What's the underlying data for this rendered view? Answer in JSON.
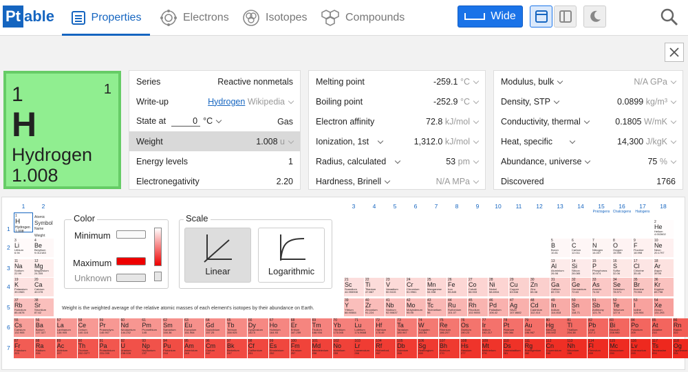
{
  "app": {
    "logo_pt": "Pt",
    "logo_able": "able"
  },
  "nav": {
    "tabs": [
      {
        "label": "Properties",
        "icon": "list-icon",
        "active": true
      },
      {
        "label": "Electrons",
        "icon": "atom-orbit-icon",
        "active": false
      },
      {
        "label": "Isotopes",
        "icon": "isotope-cluster-icon",
        "active": false
      },
      {
        "label": "Compounds",
        "icon": "hexagon-molecule-icon",
        "active": false
      }
    ],
    "wide_label": "Wide",
    "accent": "#1565c0",
    "button_blue": "#1a73e8"
  },
  "element": {
    "number": "1",
    "valence": "1",
    "symbol": "H",
    "name": "Hydrogen",
    "mass": "1.008",
    "color": "#90ee90"
  },
  "panel1": [
    {
      "label": "Series",
      "value": "Reactive nonmetals"
    },
    {
      "label": "Write-up",
      "link": "Hydrogen",
      "source": "Wikipedia"
    },
    {
      "label": "State at",
      "temp": "0",
      "unit": "°C",
      "value": "Gas"
    },
    {
      "label": "Weight",
      "value": "1.008",
      "unit": "u"
    },
    {
      "label": "Energy levels",
      "value": "1"
    },
    {
      "label": "Electronegativity",
      "value": "2.20"
    }
  ],
  "panel2": [
    {
      "label": "Melting point",
      "value": "-259.1",
      "unit": "°C"
    },
    {
      "label": "Boiling point",
      "value": "-252.9",
      "unit": "°C"
    },
    {
      "label": "Electron affinity",
      "value": "72.8",
      "unit": "kJ/mol"
    },
    {
      "label": "Ionization, 1st",
      "value": "1,312.0",
      "unit": "kJ/mol"
    },
    {
      "label": "Radius, calculated",
      "value": "53",
      "unit": "pm"
    },
    {
      "label": "Hardness, Brinell",
      "value": "N/A",
      "unit": "MPa"
    }
  ],
  "panel3": [
    {
      "label": "Modulus, bulk",
      "value": "N/A",
      "unit": "GPa"
    },
    {
      "label": "Density, STP",
      "value": "0.0899",
      "unit": "kg/m³"
    },
    {
      "label": "Conductivity, thermal",
      "value": "0.1805",
      "unit": "W/mK"
    },
    {
      "label": "Heat, specific",
      "value": "14,300",
      "unit": "J/kgK"
    },
    {
      "label": "Abundance, universe",
      "value": "75",
      "unit": "%"
    },
    {
      "label": "Discovered",
      "value": "1766"
    }
  ],
  "legend": {
    "number": "1",
    "symbol": "H",
    "name": "Hydrogen",
    "weight": "1.008",
    "text_atomic": "Atomic",
    "text_symbol": "Symbol",
    "text_name": "Name",
    "text_weight": "Weight"
  },
  "color_box": {
    "title": "Color",
    "min_label": "Minimum",
    "max_label": "Maximum",
    "unknown_label": "Unknown",
    "max_color": "#ee0000"
  },
  "scale_box": {
    "title": "Scale",
    "linear": "Linear",
    "log": "Logarithmic"
  },
  "caption": "Weight is the weighted average of the relative atomic masses of each element's isotopes by their abundance on Earth.",
  "groups": [
    "1",
    "2",
    "3",
    "4",
    "5",
    "6",
    "7",
    "8",
    "9",
    "10",
    "11",
    "12",
    "13",
    "14",
    "15",
    "16",
    "17",
    "18"
  ],
  "group_subs": {
    "15": "Pnictogens",
    "16": "Chalcogens",
    "17": "Halogens"
  },
  "periods": [
    "1",
    "2",
    "3",
    "4",
    "5",
    "6",
    "7"
  ],
  "elements": [
    {
      "n": "1",
      "s": "H",
      "name": "Hydrogen",
      "w": "1.008",
      "row": 1,
      "col": 1
    },
    {
      "n": "2",
      "s": "He",
      "name": "Helium",
      "w": "4.002602",
      "row": 1,
      "col": 18
    },
    {
      "n": "3",
      "s": "Li",
      "name": "Lithium",
      "w": "6.94",
      "row": 2,
      "col": 1
    },
    {
      "n": "4",
      "s": "Be",
      "name": "Beryllium",
      "w": "9.012183",
      "row": 2,
      "col": 2
    },
    {
      "n": "5",
      "s": "B",
      "name": "Boron",
      "w": "10.81",
      "row": 2,
      "col": 13
    },
    {
      "n": "6",
      "s": "C",
      "name": "Carbon",
      "w": "12.011",
      "row": 2,
      "col": 14
    },
    {
      "n": "7",
      "s": "N",
      "name": "Nitrogen",
      "w": "14.007",
      "row": 2,
      "col": 15
    },
    {
      "n": "8",
      "s": "O",
      "name": "Oxygen",
      "w": "15.999",
      "row": 2,
      "col": 16
    },
    {
      "n": "9",
      "s": "F",
      "name": "Fluorine",
      "w": "18.998",
      "row": 2,
      "col": 17
    },
    {
      "n": "10",
      "s": "Ne",
      "name": "Neon",
      "w": "20.1797",
      "row": 2,
      "col": 18
    },
    {
      "n": "11",
      "s": "Na",
      "name": "Sodium",
      "w": "22.99",
      "row": 3,
      "col": 1
    },
    {
      "n": "12",
      "s": "Mg",
      "name": "Magnesium",
      "w": "24.305",
      "row": 3,
      "col": 2
    },
    {
      "n": "13",
      "s": "Al",
      "name": "Aluminium",
      "w": "26.98",
      "row": 3,
      "col": 13
    },
    {
      "n": "14",
      "s": "Si",
      "name": "Silicon",
      "w": "28.085",
      "row": 3,
      "col": 14
    },
    {
      "n": "15",
      "s": "P",
      "name": "Phosphorus",
      "w": "30.974",
      "row": 3,
      "col": 15
    },
    {
      "n": "16",
      "s": "S",
      "name": "Sulfur",
      "w": "32.06",
      "row": 3,
      "col": 16
    },
    {
      "n": "17",
      "s": "Cl",
      "name": "Chlorine",
      "w": "35.45",
      "row": 3,
      "col": 17
    },
    {
      "n": "18",
      "s": "Ar",
      "name": "Argon",
      "w": "39.95",
      "row": 3,
      "col": 18
    },
    {
      "n": "19",
      "s": "K",
      "name": "Potassium",
      "w": "39.0983",
      "row": 4,
      "col": 1
    },
    {
      "n": "20",
      "s": "Ca",
      "name": "Calcium",
      "w": "40.078",
      "row": 4,
      "col": 2
    },
    {
      "n": "21",
      "s": "Sc",
      "name": "Scandium",
      "w": "44.955908",
      "row": 4,
      "col": 3
    },
    {
      "n": "22",
      "s": "Ti",
      "name": "Titanium",
      "w": "47.867",
      "row": 4,
      "col": 4
    },
    {
      "n": "23",
      "s": "V",
      "name": "Vanadium",
      "w": "50.9415",
      "row": 4,
      "col": 5
    },
    {
      "n": "24",
      "s": "Cr",
      "name": "Chromium",
      "w": "51.9961",
      "row": 4,
      "col": 6
    },
    {
      "n": "25",
      "s": "Mn",
      "name": "Manganese",
      "w": "54.938",
      "row": 4,
      "col": 7
    },
    {
      "n": "26",
      "s": "Fe",
      "name": "Iron",
      "w": "55.845",
      "row": 4,
      "col": 8
    },
    {
      "n": "27",
      "s": "Co",
      "name": "Cobalt",
      "w": "58.933",
      "row": 4,
      "col": 9
    },
    {
      "n": "28",
      "s": "Ni",
      "name": "Nickel",
      "w": "58.6934",
      "row": 4,
      "col": 10
    },
    {
      "n": "29",
      "s": "Cu",
      "name": "Copper",
      "w": "63.546",
      "row": 4,
      "col": 11
    },
    {
      "n": "30",
      "s": "Zn",
      "name": "Zinc",
      "w": "65.38",
      "row": 4,
      "col": 12
    },
    {
      "n": "31",
      "s": "Ga",
      "name": "Gallium",
      "w": "69.723",
      "row": 4,
      "col": 13
    },
    {
      "n": "32",
      "s": "Ge",
      "name": "Germanium",
      "w": "72.63",
      "row": 4,
      "col": 14
    },
    {
      "n": "33",
      "s": "As",
      "name": "Arsenic",
      "w": "74.92",
      "row": 4,
      "col": 15
    },
    {
      "n": "34",
      "s": "Se",
      "name": "Selenium",
      "w": "78.971",
      "row": 4,
      "col": 16
    },
    {
      "n": "35",
      "s": "Br",
      "name": "Bromine",
      "w": "79.904",
      "row": 4,
      "col": 17
    },
    {
      "n": "36",
      "s": "Kr",
      "name": "Krypton",
      "w": "83.798",
      "row": 4,
      "col": 18
    },
    {
      "n": "37",
      "s": "Rb",
      "name": "Rubidium",
      "w": "85.4678",
      "row": 5,
      "col": 1
    },
    {
      "n": "38",
      "s": "Sr",
      "name": "Strontium",
      "w": "87.62",
      "row": 5,
      "col": 2
    },
    {
      "n": "39",
      "s": "Y",
      "name": "Yttrium",
      "w": "88.90584",
      "row": 5,
      "col": 3
    },
    {
      "n": "40",
      "s": "Zr",
      "name": "Zirconium",
      "w": "91.224",
      "row": 5,
      "col": 4
    },
    {
      "n": "41",
      "s": "Nb",
      "name": "Niobium",
      "w": "92.90637",
      "row": 5,
      "col": 5
    },
    {
      "n": "42",
      "s": "Mo",
      "name": "Molybdenum",
      "w": "95.95",
      "row": 5,
      "col": 6
    },
    {
      "n": "43",
      "s": "Tc",
      "name": "Technetium",
      "w": "98",
      "row": 5,
      "col": 7
    },
    {
      "n": "44",
      "s": "Ru",
      "name": "Ruthenium",
      "w": "101.07",
      "row": 5,
      "col": 8
    },
    {
      "n": "45",
      "s": "Rh",
      "name": "Rhodium",
      "w": "102.9055",
      "row": 5,
      "col": 9
    },
    {
      "n": "46",
      "s": "Pd",
      "name": "Palladium",
      "w": "106.42",
      "row": 5,
      "col": 10
    },
    {
      "n": "47",
      "s": "Ag",
      "name": "Silver",
      "w": "107.8682",
      "row": 5,
      "col": 11
    },
    {
      "n": "48",
      "s": "Cd",
      "name": "Cadmium",
      "w": "112.414",
      "row": 5,
      "col": 12
    },
    {
      "n": "49",
      "s": "In",
      "name": "Indium",
      "w": "114.818",
      "row": 5,
      "col": 13
    },
    {
      "n": "50",
      "s": "Sn",
      "name": "Tin",
      "w": "118.71",
      "row": 5,
      "col": 14
    },
    {
      "n": "51",
      "s": "Sb",
      "name": "Antimony",
      "w": "121.76",
      "row": 5,
      "col": 15
    },
    {
      "n": "52",
      "s": "Te",
      "name": "Tellurium",
      "w": "127.6",
      "row": 5,
      "col": 16
    },
    {
      "n": "53",
      "s": "I",
      "name": "Iodine",
      "w": "126.904",
      "row": 5,
      "col": 17
    },
    {
      "n": "54",
      "s": "Xe",
      "name": "Xenon",
      "w": "131.293",
      "row": 5,
      "col": 18
    },
    {
      "n": "55",
      "s": "Cs",
      "name": "Caesium",
      "w": "132.905",
      "row": 6,
      "col": 1
    },
    {
      "n": "56",
      "s": "Ba",
      "name": "Barium",
      "w": "137.327",
      "row": 6,
      "col": 2
    },
    {
      "n": "57",
      "s": "La",
      "name": "Lanthanum",
      "w": "138.905",
      "row": 6,
      "col": 3
    },
    {
      "n": "58",
      "s": "Ce",
      "name": "Cerium",
      "w": "140.116",
      "row": 6,
      "col": 4
    },
    {
      "n": "59",
      "s": "Pr",
      "name": "Praseodym.",
      "w": "140.907",
      "row": 6,
      "col": 5
    },
    {
      "n": "60",
      "s": "Nd",
      "name": "Neodymium",
      "w": "144.242",
      "row": 6,
      "col": 6
    },
    {
      "n": "61",
      "s": "Pm",
      "name": "Promethium",
      "w": "145",
      "row": 6,
      "col": 7
    },
    {
      "n": "62",
      "s": "Sm",
      "name": "Samarium",
      "w": "150.36",
      "row": 6,
      "col": 8
    },
    {
      "n": "63",
      "s": "Eu",
      "name": "Europium",
      "w": "151.964",
      "row": 6,
      "col": 9
    },
    {
      "n": "64",
      "s": "Gd",
      "name": "Gadolinium",
      "w": "157.25",
      "row": 6,
      "col": 10
    },
    {
      "n": "65",
      "s": "Tb",
      "name": "Terbium",
      "w": "158.925",
      "row": 6,
      "col": 11
    },
    {
      "n": "66",
      "s": "Dy",
      "name": "Dysprosium",
      "w": "162.5",
      "row": 6,
      "col": 12
    },
    {
      "n": "67",
      "s": "Ho",
      "name": "Holmium",
      "w": "164.93",
      "row": 6,
      "col": 13
    },
    {
      "n": "68",
      "s": "Er",
      "name": "Erbium",
      "w": "167.259",
      "row": 6,
      "col": 14
    },
    {
      "n": "69",
      "s": "Tm",
      "name": "Thulium",
      "w": "168.934",
      "row": 6,
      "col": 15
    },
    {
      "n": "70",
      "s": "Yb",
      "name": "Ytterbium",
      "w": "173.045",
      "row": 6,
      "col": 16
    },
    {
      "n": "71",
      "s": "Lu",
      "name": "Lutetium",
      "w": "174.9668",
      "row": 6,
      "col": 17
    },
    {
      "n": "72",
      "s": "Hf",
      "name": "Hafnium",
      "w": "178.49",
      "row": 6,
      "col": 18
    },
    {
      "n": "73",
      "s": "Ta",
      "name": "Tantalum",
      "w": "180.947",
      "row": 6,
      "col": 19
    },
    {
      "n": "74",
      "s": "W",
      "name": "Tungsten",
      "w": "183.84",
      "row": 6,
      "col": 20
    },
    {
      "n": "75",
      "s": "Re",
      "name": "Rhenium",
      "w": "186.207",
      "row": 6,
      "col": 21
    },
    {
      "n": "76",
      "s": "Os",
      "name": "Osmium",
      "w": "190.23",
      "row": 6,
      "col": 22
    },
    {
      "n": "77",
      "s": "Ir",
      "name": "Iridium",
      "w": "192.217",
      "row": 6,
      "col": 23
    },
    {
      "n": "78",
      "s": "Pt",
      "name": "Platinum",
      "w": "195.084",
      "row": 6,
      "col": 24
    },
    {
      "n": "79",
      "s": "Au",
      "name": "Gold",
      "w": "196.967",
      "row": 6,
      "col": 25
    },
    {
      "n": "80",
      "s": "Hg",
      "name": "Mercury",
      "w": "200.592",
      "row": 6,
      "col": 26
    },
    {
      "n": "81",
      "s": "Tl",
      "name": "Thallium",
      "w": "204.38",
      "row": 6,
      "col": 27
    },
    {
      "n": "82",
      "s": "Pb",
      "name": "Lead",
      "w": "207.2",
      "row": 6,
      "col": 28
    },
    {
      "n": "83",
      "s": "Bi",
      "name": "Bismuth",
      "w": "208.980",
      "row": 6,
      "col": 29
    },
    {
      "n": "84",
      "s": "Po",
      "name": "Polonium",
      "w": "209",
      "row": 6,
      "col": 30
    },
    {
      "n": "85",
      "s": "At",
      "name": "Astatine",
      "w": "210",
      "row": 6,
      "col": 31
    },
    {
      "n": "86",
      "s": "Rn",
      "name": "Radon",
      "w": "222",
      "row": 6,
      "col": 32
    },
    {
      "n": "87",
      "s": "Fr",
      "name": "Francium",
      "w": "223",
      "row": 7,
      "col": 1
    },
    {
      "n": "88",
      "s": "Ra",
      "name": "Radium",
      "w": "226",
      "row": 7,
      "col": 2
    },
    {
      "n": "89",
      "s": "Ac",
      "name": "Actinium",
      "w": "227",
      "row": 7,
      "col": 3
    },
    {
      "n": "90",
      "s": "Th",
      "name": "Thorium",
      "w": "232.0377",
      "row": 7,
      "col": 4
    },
    {
      "n": "91",
      "s": "Pa",
      "name": "Protactinium",
      "w": "231.035",
      "row": 7,
      "col": 5
    },
    {
      "n": "92",
      "s": "U",
      "name": "Uranium",
      "w": "238.028",
      "row": 7,
      "col": 6
    },
    {
      "n": "93",
      "s": "Np",
      "name": "Neptunium",
      "w": "237",
      "row": 7,
      "col": 7
    },
    {
      "n": "94",
      "s": "Pu",
      "name": "Plutonium",
      "w": "244",
      "row": 7,
      "col": 8
    },
    {
      "n": "95",
      "s": "Am",
      "name": "Americium",
      "w": "243",
      "row": 7,
      "col": 9
    },
    {
      "n": "96",
      "s": "Cm",
      "name": "Curium",
      "w": "247",
      "row": 7,
      "col": 10
    },
    {
      "n": "97",
      "s": "Bk",
      "name": "Berkelium",
      "w": "247",
      "row": 7,
      "col": 11
    },
    {
      "n": "98",
      "s": "Cf",
      "name": "Californium",
      "w": "251",
      "row": 7,
      "col": 12
    },
    {
      "n": "99",
      "s": "Es",
      "name": "Einsteinium",
      "w": "252",
      "row": 7,
      "col": 13
    },
    {
      "n": "100",
      "s": "Fm",
      "name": "Fermium",
      "w": "257",
      "row": 7,
      "col": 14
    },
    {
      "n": "101",
      "s": "Md",
      "name": "Mendelevium",
      "w": "258",
      "row": 7,
      "col": 15
    },
    {
      "n": "102",
      "s": "No",
      "name": "Nobelium",
      "w": "259",
      "row": 7,
      "col": 16
    },
    {
      "n": "103",
      "s": "Lr",
      "name": "Lawrencium",
      "w": "266",
      "row": 7,
      "col": 17
    },
    {
      "n": "104",
      "s": "Rf",
      "name": "Rutherford.",
      "w": "267",
      "row": 7,
      "col": 18
    },
    {
      "n": "105",
      "s": "Db",
      "name": "Dubnium",
      "w": "268",
      "row": 7,
      "col": 19
    },
    {
      "n": "106",
      "s": "Sg",
      "name": "Seaborgium",
      "w": "269",
      "row": 7,
      "col": 20
    },
    {
      "n": "107",
      "s": "Bh",
      "name": "Bohrium",
      "w": "270",
      "row": 7,
      "col": 21
    },
    {
      "n": "108",
      "s": "Hs",
      "name": "Hassium",
      "w": "277",
      "row": 7,
      "col": 22
    },
    {
      "n": "109",
      "s": "Mt",
      "name": "Meitnerium",
      "w": "278",
      "row": 7,
      "col": 23
    },
    {
      "n": "110",
      "s": "Ds",
      "name": "Darmstadtium",
      "w": "281",
      "row": 7,
      "col": 24
    },
    {
      "n": "111",
      "s": "Rg",
      "name": "Roentgenium",
      "w": "282",
      "row": 7,
      "col": 25
    },
    {
      "n": "112",
      "s": "Cn",
      "name": "Copernicium",
      "w": "285",
      "row": 7,
      "col": 26
    },
    {
      "n": "113",
      "s": "Nh",
      "name": "Nihonium",
      "w": "286",
      "row": 7,
      "col": 27
    },
    {
      "n": "114",
      "s": "Fl",
      "name": "Flerovium",
      "w": "289",
      "row": 7,
      "col": 28
    },
    {
      "n": "115",
      "s": "Mc",
      "name": "Moscovium",
      "w": "290",
      "row": 7,
      "col": 29
    },
    {
      "n": "116",
      "s": "Lv",
      "name": "Livermorium",
      "w": "293",
      "row": 7,
      "col": 30
    },
    {
      "n": "117",
      "s": "Ts",
      "name": "Tennessine",
      "w": "294",
      "row": 7,
      "col": 31
    },
    {
      "n": "118",
      "s": "Og",
      "name": "Oganesson",
      "w": "294",
      "row": 7,
      "col": 32
    }
  ]
}
